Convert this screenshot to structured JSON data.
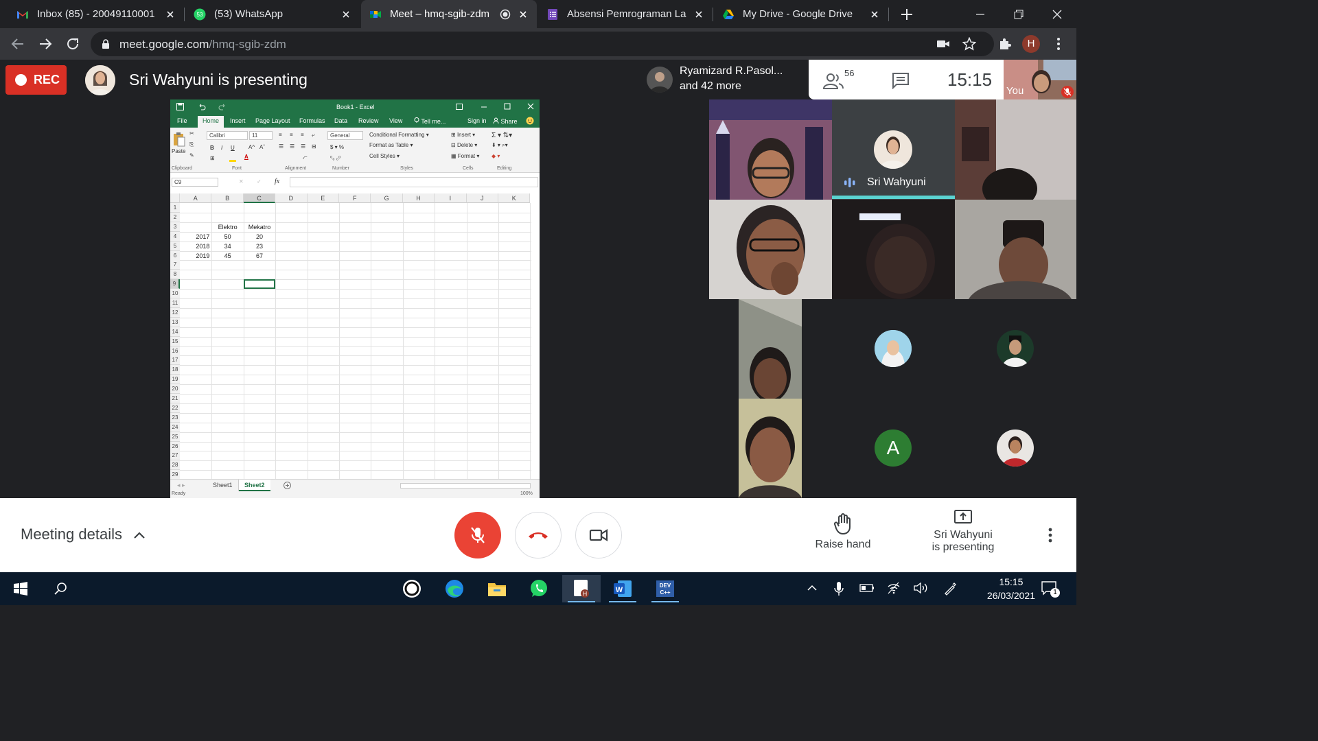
{
  "browser": {
    "tabs": [
      {
        "title": "Inbox (85) - 20049110001",
        "icon": "gmail-icon",
        "active": false
      },
      {
        "title": "(53) WhatsApp",
        "icon": "whatsapp-icon",
        "active": false
      },
      {
        "title": "Meet – hmq-sgib-zdm",
        "icon": "meet-icon",
        "active": true
      },
      {
        "title": "Absensi Pemrograman Lanj",
        "icon": "forms-icon",
        "active": false
      },
      {
        "title": "My Drive - Google Drive",
        "icon": "drive-icon",
        "active": false
      }
    ],
    "whatsapp_badge": "53",
    "url_host": "meet.google.com",
    "url_path": "/hmq-sgib-zdm",
    "profile_initial": "H"
  },
  "meet": {
    "rec_label": "REC",
    "presenting_title": "Sri Wahyuni is presenting",
    "top_participants": "Ryamizard R.Pasol...",
    "top_more": "and 42 more",
    "participant_count": "56",
    "clock": "15:15",
    "you_label": "You",
    "speaker_name": "Sri Wahyuni",
    "avatar_letter": "A",
    "accent_color": "#1a73e8",
    "meeting_details_label": "Meeting details",
    "raise_hand_label": "Raise hand",
    "present_label_line1": "Sri Wahyuni",
    "present_label_line2": "is presenting"
  },
  "excel": {
    "title": "Book1 - Excel",
    "tabs": [
      "File",
      "Home",
      "Insert",
      "Page Layout",
      "Formulas",
      "Data",
      "Review",
      "View"
    ],
    "tell_me": "Tell me...",
    "sign_in": "Sign in",
    "share": "Share",
    "font_name": "Calibri",
    "font_size": "11",
    "number_format": "General",
    "ribbon": {
      "paste": "Paste",
      "conditional_formatting": "Conditional Formatting",
      "format_as_table": "Format as Table",
      "cell_styles": "Cell Styles",
      "insert": "Insert",
      "delete": "Delete",
      "format": "Format",
      "groups": [
        "Clipboard",
        "Font",
        "Alignment",
        "Number",
        "Styles",
        "Cells",
        "Editing"
      ]
    },
    "name_box": "C9",
    "columns": [
      "A",
      "B",
      "C",
      "D",
      "E",
      "F",
      "G",
      "H",
      "I",
      "J",
      "K"
    ],
    "rows": [
      "1",
      "2",
      "3",
      "4",
      "5",
      "6",
      "7",
      "8",
      "9",
      "10",
      "11",
      "12",
      "13",
      "14",
      "15",
      "16",
      "17",
      "18",
      "19",
      "20",
      "21",
      "22",
      "23",
      "24",
      "25",
      "26",
      "27",
      "28",
      "29"
    ],
    "headers": {
      "b": "Elektro",
      "c": "Mekatro"
    },
    "data_rows": [
      {
        "year": "2017",
        "elektro": "50",
        "mekatro": "20"
      },
      {
        "year": "2018",
        "elektro": "34",
        "mekatro": "23"
      },
      {
        "year": "2019",
        "elektro": "45",
        "mekatro": "67"
      }
    ],
    "sheets": [
      "Sheet1",
      "Sheet2"
    ],
    "active_sheet": "Sheet2",
    "status": "Ready",
    "zoom": "100%"
  },
  "taskbar": {
    "time": "15:15",
    "date": "26/03/2021",
    "notification_count": "1",
    "apps": [
      "signal-icon",
      "edge-icon",
      "file-explorer-icon",
      "whatsapp-icon",
      "meet-app-icon",
      "word-icon",
      "devcpp-icon"
    ]
  }
}
